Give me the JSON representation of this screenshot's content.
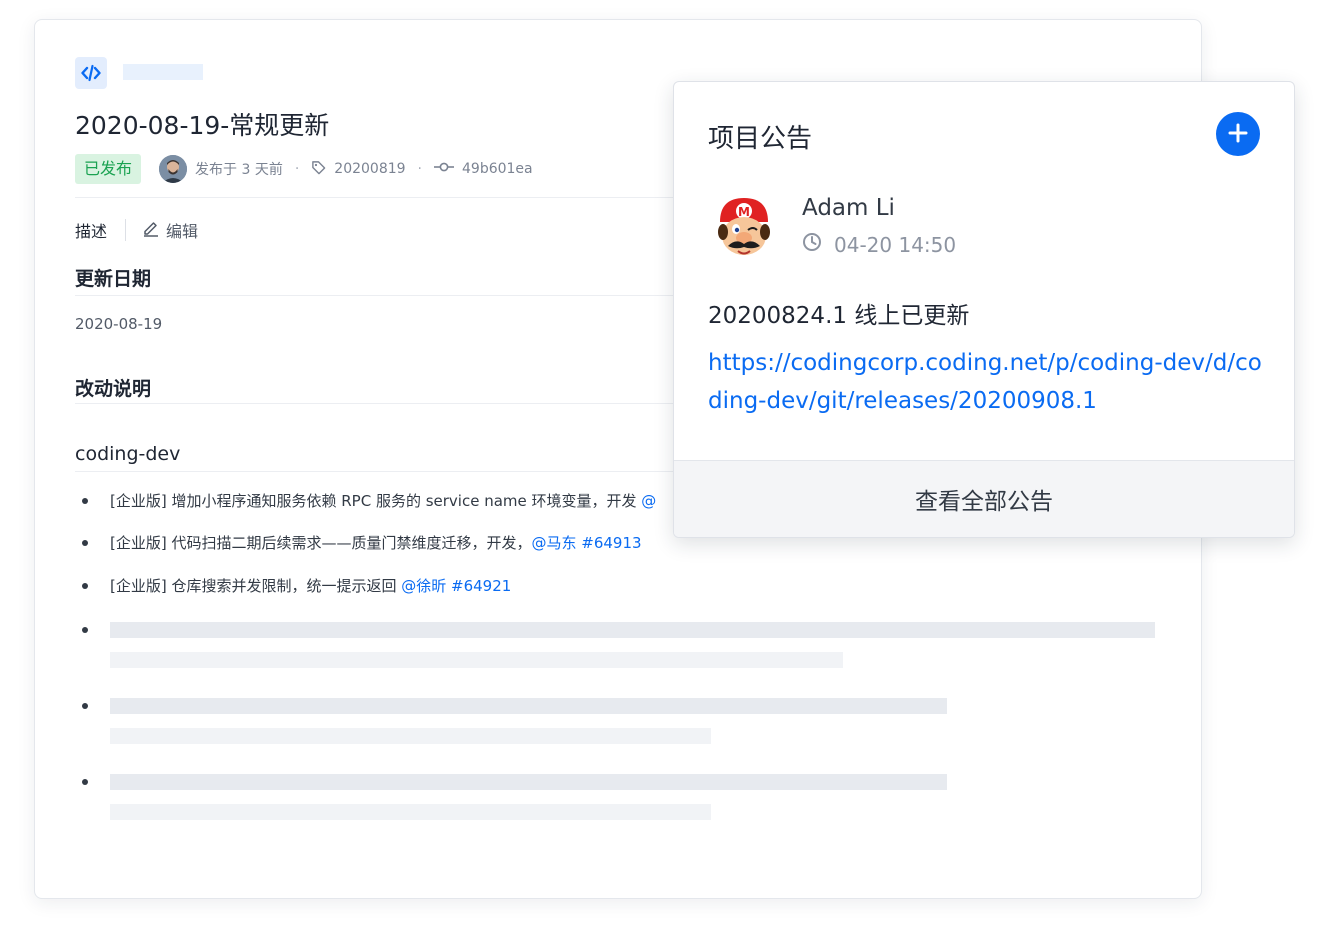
{
  "release": {
    "title": "2020-08-19-常规更新",
    "status": "已发布",
    "published": "发布于 3 天前",
    "tag": "20200819",
    "commit": "49b601ea",
    "separator": "·"
  },
  "tabs": {
    "description": "描述",
    "edit": "编辑"
  },
  "content": {
    "update_date_heading": "更新日期",
    "update_date": "2020-08-19",
    "changes_heading": "改动说明",
    "repo_heading": "coding-dev",
    "items": [
      {
        "text": "[企业版] 增加小程序通知服务依赖 RPC 服务的 service name 环境变量，开发 ",
        "mention": "@"
      },
      {
        "text": "[企业版] 代码扫描二期后续需求——质量门禁维度迁移，开发，",
        "mention": "@马东 #64913"
      },
      {
        "text": "[企业版] 仓库搜索并发限制，统一提示返回 ",
        "mention": "@徐昕 #64921"
      }
    ]
  },
  "announcement": {
    "title": "项目公告",
    "author": "Adam Li",
    "time": "04-20 14:50",
    "text": "20200824.1 线上已更新",
    "link": "https://codingcorp.coding.net/p/coding-dev/d/coding-dev/git/releases/20200908.1",
    "view_all": "查看全部公告"
  },
  "colors": {
    "accent": "#0a6bf2",
    "published_bg": "#d9f3e1",
    "published_text": "#1aa251"
  },
  "icons": [
    "code-icon",
    "tag-icon",
    "commit-icon",
    "pencil-icon",
    "plus-icon",
    "clock-icon"
  ]
}
